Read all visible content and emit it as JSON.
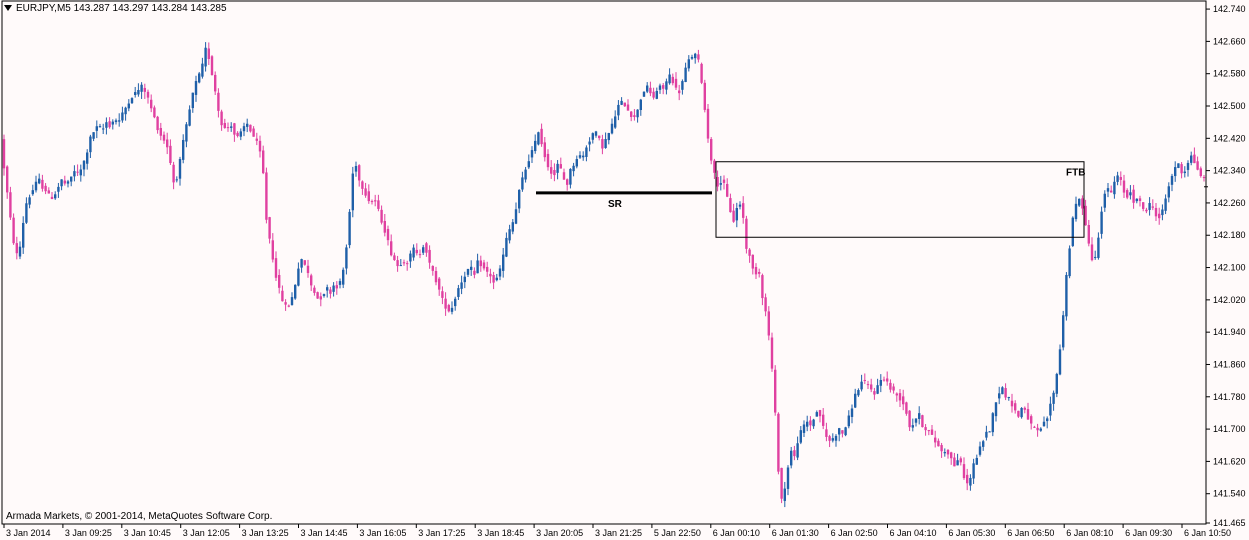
{
  "header": {
    "symbol": "EURJPY,M5",
    "ohlc": "143.287 143.297 143.284 143.285"
  },
  "copyright": "Armada Markets, © 2001-2014, MetaQuotes Software Corp.",
  "annotations": {
    "sr_label": "SR",
    "ftb_label": "FTB"
  },
  "colors": {
    "background": "#fffafa",
    "bull": "#1f5fa8",
    "bear": "#e040a0",
    "axis": "#000000"
  },
  "chart_data": {
    "type": "candlestick",
    "title": "",
    "grid": false,
    "y_ticks": [
      "142.740",
      "142.660",
      "142.580",
      "142.500",
      "142.420",
      "142.340",
      "142.260",
      "142.180",
      "142.100",
      "142.020",
      "141.940",
      "141.860",
      "141.780",
      "141.700",
      "141.620",
      "141.540",
      "141.465"
    ],
    "x_ticks": [
      "3 Jan 2014",
      "3 Jan 09:25",
      "3 Jan 10:45",
      "3 Jan 12:05",
      "3 Jan 13:25",
      "3 Jan 14:45",
      "3 Jan 16:05",
      "3 Jan 17:25",
      "3 Jan 18:45",
      "3 Jan 20:05",
      "3 Jan 21:25",
      "5 Jan 22:50",
      "6 Jan 00:10",
      "6 Jan 01:30",
      "6 Jan 02:50",
      "6 Jan 04:10",
      "6 Jan 05:30",
      "6 Jan 06:50",
      "6 Jan 08:10",
      "6 Jan 09:30",
      "6 Jan 10:50"
    ],
    "ylim": [
      141.465,
      142.76
    ],
    "price_path": [
      [
        0,
        142.47
      ],
      [
        4,
        142.38
      ],
      [
        8,
        142.3
      ],
      [
        12,
        142.22
      ],
      [
        16,
        142.15
      ],
      [
        20,
        142.12
      ],
      [
        24,
        142.2
      ],
      [
        28,
        142.26
      ],
      [
        32,
        142.28
      ],
      [
        36,
        142.3
      ],
      [
        40,
        142.32
      ],
      [
        44,
        142.3
      ],
      [
        48,
        142.29
      ],
      [
        52,
        142.27
      ],
      [
        56,
        142.28
      ],
      [
        60,
        142.3
      ],
      [
        64,
        142.32
      ],
      [
        68,
        142.3
      ],
      [
        72,
        142.32
      ],
      [
        76,
        142.34
      ],
      [
        80,
        142.33
      ],
      [
        84,
        142.35
      ],
      [
        88,
        142.38
      ],
      [
        92,
        142.42
      ],
      [
        96,
        142.44
      ],
      [
        100,
        142.45
      ],
      [
        104,
        142.44
      ],
      [
        108,
        142.46
      ],
      [
        112,
        142.45
      ],
      [
        116,
        142.47
      ],
      [
        120,
        142.46
      ],
      [
        124,
        142.48
      ],
      [
        128,
        142.5
      ],
      [
        132,
        142.52
      ],
      [
        136,
        142.53
      ],
      [
        140,
        142.54
      ],
      [
        144,
        142.55
      ],
      [
        148,
        142.53
      ],
      [
        152,
        142.5
      ],
      [
        156,
        142.47
      ],
      [
        160,
        142.44
      ],
      [
        164,
        142.42
      ],
      [
        168,
        142.41
      ],
      [
        172,
        142.36
      ],
      [
        176,
        142.3
      ],
      [
        180,
        142.34
      ],
      [
        184,
        142.4
      ],
      [
        188,
        142.45
      ],
      [
        192,
        142.5
      ],
      [
        196,
        142.55
      ],
      [
        200,
        142.57
      ],
      [
        204,
        142.6
      ],
      [
        208,
        142.65
      ],
      [
        212,
        142.6
      ],
      [
        216,
        142.55
      ],
      [
        220,
        142.49
      ],
      [
        224,
        142.45
      ],
      [
        228,
        142.44
      ],
      [
        232,
        142.46
      ],
      [
        236,
        142.43
      ],
      [
        240,
        142.42
      ],
      [
        244,
        142.44
      ],
      [
        248,
        142.46
      ],
      [
        252,
        142.44
      ],
      [
        256,
        142.42
      ],
      [
        260,
        142.4
      ],
      [
        264,
        142.36
      ],
      [
        268,
        142.22
      ],
      [
        272,
        142.16
      ],
      [
        276,
        142.1
      ],
      [
        280,
        142.05
      ],
      [
        284,
        142.02
      ],
      [
        288,
        142.0
      ],
      [
        292,
        142.01
      ],
      [
        296,
        142.05
      ],
      [
        300,
        142.1
      ],
      [
        304,
        142.12
      ],
      [
        308,
        142.1
      ],
      [
        312,
        142.06
      ],
      [
        316,
        142.04
      ],
      [
        320,
        142.02
      ],
      [
        324,
        142.03
      ],
      [
        328,
        142.05
      ],
      [
        332,
        142.04
      ],
      [
        336,
        142.06
      ],
      [
        340,
        142.05
      ],
      [
        344,
        142.08
      ],
      [
        348,
        142.15
      ],
      [
        352,
        142.26
      ],
      [
        356,
        142.38
      ],
      [
        360,
        142.32
      ],
      [
        364,
        142.3
      ],
      [
        368,
        142.28
      ],
      [
        372,
        142.26
      ],
      [
        376,
        142.27
      ],
      [
        380,
        142.24
      ],
      [
        384,
        142.21
      ],
      [
        388,
        142.18
      ],
      [
        392,
        142.14
      ],
      [
        396,
        142.12
      ],
      [
        400,
        142.1
      ],
      [
        404,
        142.12
      ],
      [
        408,
        142.11
      ],
      [
        412,
        142.13
      ],
      [
        416,
        142.15
      ],
      [
        420,
        142.12
      ],
      [
        424,
        142.16
      ],
      [
        428,
        142.14
      ],
      [
        432,
        142.1
      ],
      [
        436,
        142.08
      ],
      [
        440,
        142.05
      ],
      [
        444,
        142.02
      ],
      [
        448,
        142.0
      ],
      [
        452,
        141.99
      ],
      [
        456,
        142.02
      ],
      [
        460,
        142.05
      ],
      [
        464,
        142.07
      ],
      [
        468,
        142.09
      ],
      [
        472,
        142.1
      ],
      [
        476,
        142.08
      ],
      [
        480,
        142.12
      ],
      [
        484,
        142.1
      ],
      [
        488,
        142.09
      ],
      [
        492,
        142.08
      ],
      [
        496,
        142.06
      ],
      [
        500,
        142.08
      ],
      [
        504,
        142.12
      ],
      [
        508,
        142.17
      ],
      [
        512,
        142.2
      ],
      [
        516,
        142.22
      ],
      [
        520,
        142.28
      ],
      [
        524,
        142.32
      ],
      [
        528,
        142.35
      ],
      [
        532,
        142.38
      ],
      [
        536,
        142.4
      ],
      [
        540,
        142.44
      ],
      [
        544,
        142.4
      ],
      [
        548,
        142.36
      ],
      [
        552,
        142.34
      ],
      [
        556,
        142.33
      ],
      [
        560,
        142.36
      ],
      [
        564,
        142.33
      ],
      [
        568,
        142.3
      ],
      [
        572,
        142.34
      ],
      [
        576,
        142.36
      ],
      [
        580,
        142.38
      ],
      [
        584,
        142.37
      ],
      [
        588,
        142.4
      ],
      [
        592,
        142.42
      ],
      [
        596,
        142.44
      ],
      [
        600,
        142.42
      ],
      [
        604,
        142.4
      ],
      [
        608,
        142.42
      ],
      [
        612,
        142.44
      ],
      [
        616,
        142.47
      ],
      [
        620,
        142.5
      ],
      [
        624,
        142.51
      ],
      [
        628,
        142.5
      ],
      [
        632,
        142.48
      ],
      [
        636,
        142.47
      ],
      [
        640,
        142.5
      ],
      [
        644,
        142.53
      ],
      [
        648,
        142.55
      ],
      [
        652,
        142.53
      ],
      [
        656,
        142.52
      ],
      [
        660,
        142.55
      ],
      [
        664,
        142.54
      ],
      [
        668,
        142.56
      ],
      [
        672,
        142.58
      ],
      [
        676,
        142.55
      ],
      [
        680,
        142.53
      ],
      [
        684,
        142.56
      ],
      [
        688,
        142.6
      ],
      [
        692,
        142.62
      ],
      [
        696,
        142.63
      ],
      [
        700,
        142.61
      ],
      [
        704,
        142.55
      ],
      [
        708,
        142.45
      ],
      [
        712,
        142.38
      ],
      [
        716,
        142.33
      ],
      [
        720,
        142.3
      ],
      [
        724,
        142.32
      ],
      [
        728,
        142.28
      ],
      [
        732,
        142.24
      ],
      [
        736,
        142.21
      ],
      [
        740,
        142.27
      ],
      [
        744,
        142.24
      ],
      [
        748,
        142.15
      ],
      [
        752,
        142.12
      ],
      [
        756,
        142.08
      ],
      [
        760,
        142.1
      ],
      [
        764,
        142.03
      ],
      [
        768,
        141.98
      ],
      [
        772,
        141.9
      ],
      [
        776,
        141.77
      ],
      [
        780,
        141.6
      ],
      [
        784,
        141.51
      ],
      [
        788,
        141.58
      ],
      [
        792,
        141.65
      ],
      [
        796,
        141.63
      ],
      [
        800,
        141.68
      ],
      [
        804,
        141.7
      ],
      [
        808,
        141.72
      ],
      [
        812,
        141.71
      ],
      [
        816,
        141.73
      ],
      [
        820,
        141.75
      ],
      [
        824,
        141.71
      ],
      [
        828,
        141.68
      ],
      [
        832,
        141.67
      ],
      [
        836,
        141.68
      ],
      [
        840,
        141.7
      ],
      [
        844,
        141.69
      ],
      [
        848,
        141.71
      ],
      [
        852,
        141.74
      ],
      [
        856,
        141.78
      ],
      [
        860,
        141.8
      ],
      [
        864,
        141.82
      ],
      [
        868,
        141.81
      ],
      [
        872,
        141.8
      ],
      [
        876,
        141.79
      ],
      [
        880,
        141.81
      ],
      [
        884,
        141.83
      ],
      [
        888,
        141.82
      ],
      [
        892,
        141.8
      ],
      [
        896,
        141.79
      ],
      [
        900,
        141.78
      ],
      [
        904,
        141.77
      ],
      [
        908,
        141.74
      ],
      [
        912,
        141.7
      ],
      [
        916,
        141.72
      ],
      [
        920,
        141.74
      ],
      [
        924,
        141.71
      ],
      [
        928,
        141.7
      ],
      [
        932,
        141.69
      ],
      [
        936,
        141.67
      ],
      [
        940,
        141.66
      ],
      [
        944,
        141.64
      ],
      [
        948,
        141.65
      ],
      [
        952,
        141.63
      ],
      [
        956,
        141.61
      ],
      [
        960,
        141.63
      ],
      [
        964,
        141.6
      ],
      [
        968,
        141.56
      ],
      [
        972,
        141.58
      ],
      [
        976,
        141.62
      ],
      [
        980,
        141.64
      ],
      [
        984,
        141.67
      ],
      [
        988,
        141.69
      ],
      [
        992,
        141.7
      ],
      [
        996,
        141.76
      ],
      [
        1000,
        141.79
      ],
      [
        1004,
        141.8
      ],
      [
        1008,
        141.78
      ],
      [
        1012,
        141.77
      ],
      [
        1016,
        141.75
      ],
      [
        1020,
        141.73
      ],
      [
        1024,
        141.76
      ],
      [
        1028,
        141.74
      ],
      [
        1032,
        141.71
      ],
      [
        1036,
        141.7
      ],
      [
        1040,
        141.69
      ],
      [
        1044,
        141.71
      ],
      [
        1048,
        141.72
      ],
      [
        1052,
        141.76
      ],
      [
        1056,
        141.8
      ],
      [
        1060,
        141.86
      ],
      [
        1064,
        141.96
      ],
      [
        1068,
        142.08
      ],
      [
        1072,
        142.17
      ],
      [
        1076,
        142.25
      ],
      [
        1080,
        142.27
      ],
      [
        1084,
        142.25
      ],
      [
        1088,
        142.2
      ],
      [
        1092,
        142.13
      ],
      [
        1096,
        142.11
      ],
      [
        1100,
        142.18
      ],
      [
        1104,
        142.26
      ],
      [
        1108,
        142.3
      ],
      [
        1112,
        142.28
      ],
      [
        1116,
        142.31
      ],
      [
        1120,
        142.33
      ],
      [
        1124,
        142.3
      ],
      [
        1128,
        142.27
      ],
      [
        1132,
        142.29
      ],
      [
        1136,
        142.26
      ],
      [
        1140,
        142.27
      ],
      [
        1144,
        142.25
      ],
      [
        1148,
        142.24
      ],
      [
        1152,
        142.26
      ],
      [
        1156,
        142.24
      ],
      [
        1160,
        142.22
      ],
      [
        1164,
        142.24
      ],
      [
        1168,
        142.28
      ],
      [
        1172,
        142.32
      ],
      [
        1176,
        142.34
      ],
      [
        1180,
        142.36
      ],
      [
        1184,
        142.33
      ],
      [
        1188,
        142.35
      ],
      [
        1192,
        142.38
      ],
      [
        1196,
        142.36
      ],
      [
        1200,
        142.34
      ],
      [
        1204,
        142.32
      ]
    ],
    "sr_line": {
      "price": 142.285,
      "label": "SR"
    },
    "ftb_box": {
      "top": 142.362,
      "bottom": 142.175,
      "label": "FTB"
    }
  }
}
